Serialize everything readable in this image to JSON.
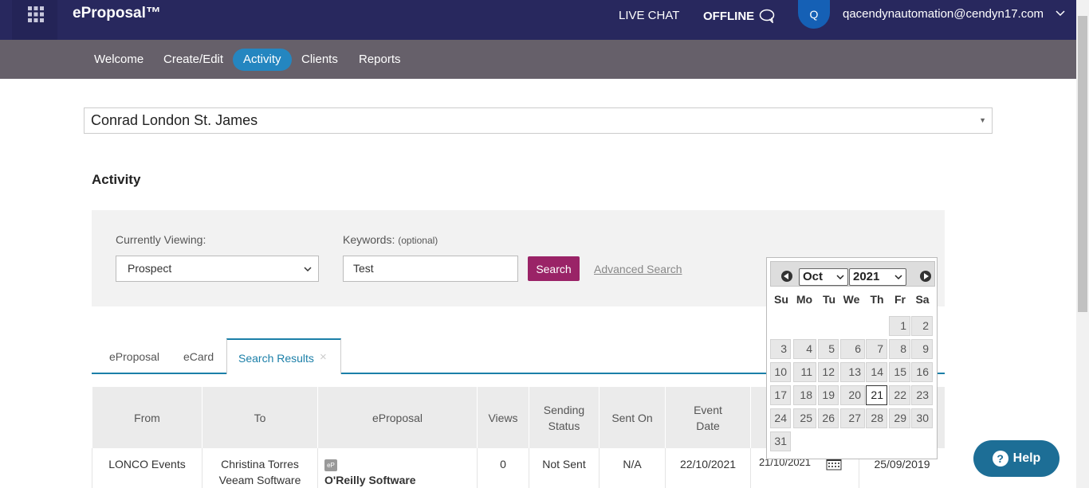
{
  "header": {
    "brand": "eProposal™",
    "live_chat": "LIVE CHAT",
    "offline": "OFFLINE",
    "avatar_initial": "Q",
    "user_email": "qacendynautomation@cendyn17.com"
  },
  "nav": {
    "items": [
      "Welcome",
      "Create/Edit",
      "Activity",
      "Clients",
      "Reports"
    ],
    "active": "Activity"
  },
  "property_select": {
    "value": "Conrad London St. James"
  },
  "page_title": "Activity",
  "search_panel": {
    "viewing_label": "Currently Viewing:",
    "viewing_value": "Prospect",
    "keywords_label": "Keywords:",
    "keywords_optional": "(optional)",
    "keywords_value": "Test",
    "search_button": "Search",
    "advanced_link": "Advanced Search"
  },
  "tabs": {
    "eproposal": "eProposal",
    "ecard": "eCard",
    "search_results": "Search Results",
    "close_glyph": "×"
  },
  "table": {
    "headers": [
      "From",
      "To",
      "eProposal",
      "Views",
      "Sending Status",
      "Sent On",
      "Event Date",
      "",
      ""
    ],
    "row": {
      "from": "LONCO Events",
      "to_name": "Christina Torres",
      "to_company": "Veeam Software",
      "eproposal_badge": "eP",
      "eproposal_name": "O'Reilly Software",
      "views": "0",
      "status": "Not Sent",
      "sent_on": "N/A",
      "event_date": "22/10/2021",
      "date2": "21/10/2021",
      "date3": "25/09/2019"
    }
  },
  "datepicker": {
    "month": "Oct",
    "year": "2021",
    "weekdays": [
      "Su",
      "Mo",
      "Tu",
      "We",
      "Th",
      "Fr",
      "Sa"
    ],
    "today": "21",
    "days": [
      "1",
      "2",
      "3",
      "4",
      "5",
      "6",
      "7",
      "8",
      "9",
      "10",
      "11",
      "12",
      "13",
      "14",
      "15",
      "16",
      "17",
      "18",
      "19",
      "20",
      "21",
      "22",
      "23",
      "24",
      "25",
      "26",
      "27",
      "28",
      "29",
      "30",
      "31"
    ]
  },
  "help": {
    "label": "Help",
    "icon": "?"
  },
  "colors": {
    "topbar": "#28285e",
    "subnav": "#66606a",
    "active_nav": "#2486c0",
    "search_button": "#9a2367",
    "accent": "#1b7fa8",
    "help": "#1d6e96"
  }
}
